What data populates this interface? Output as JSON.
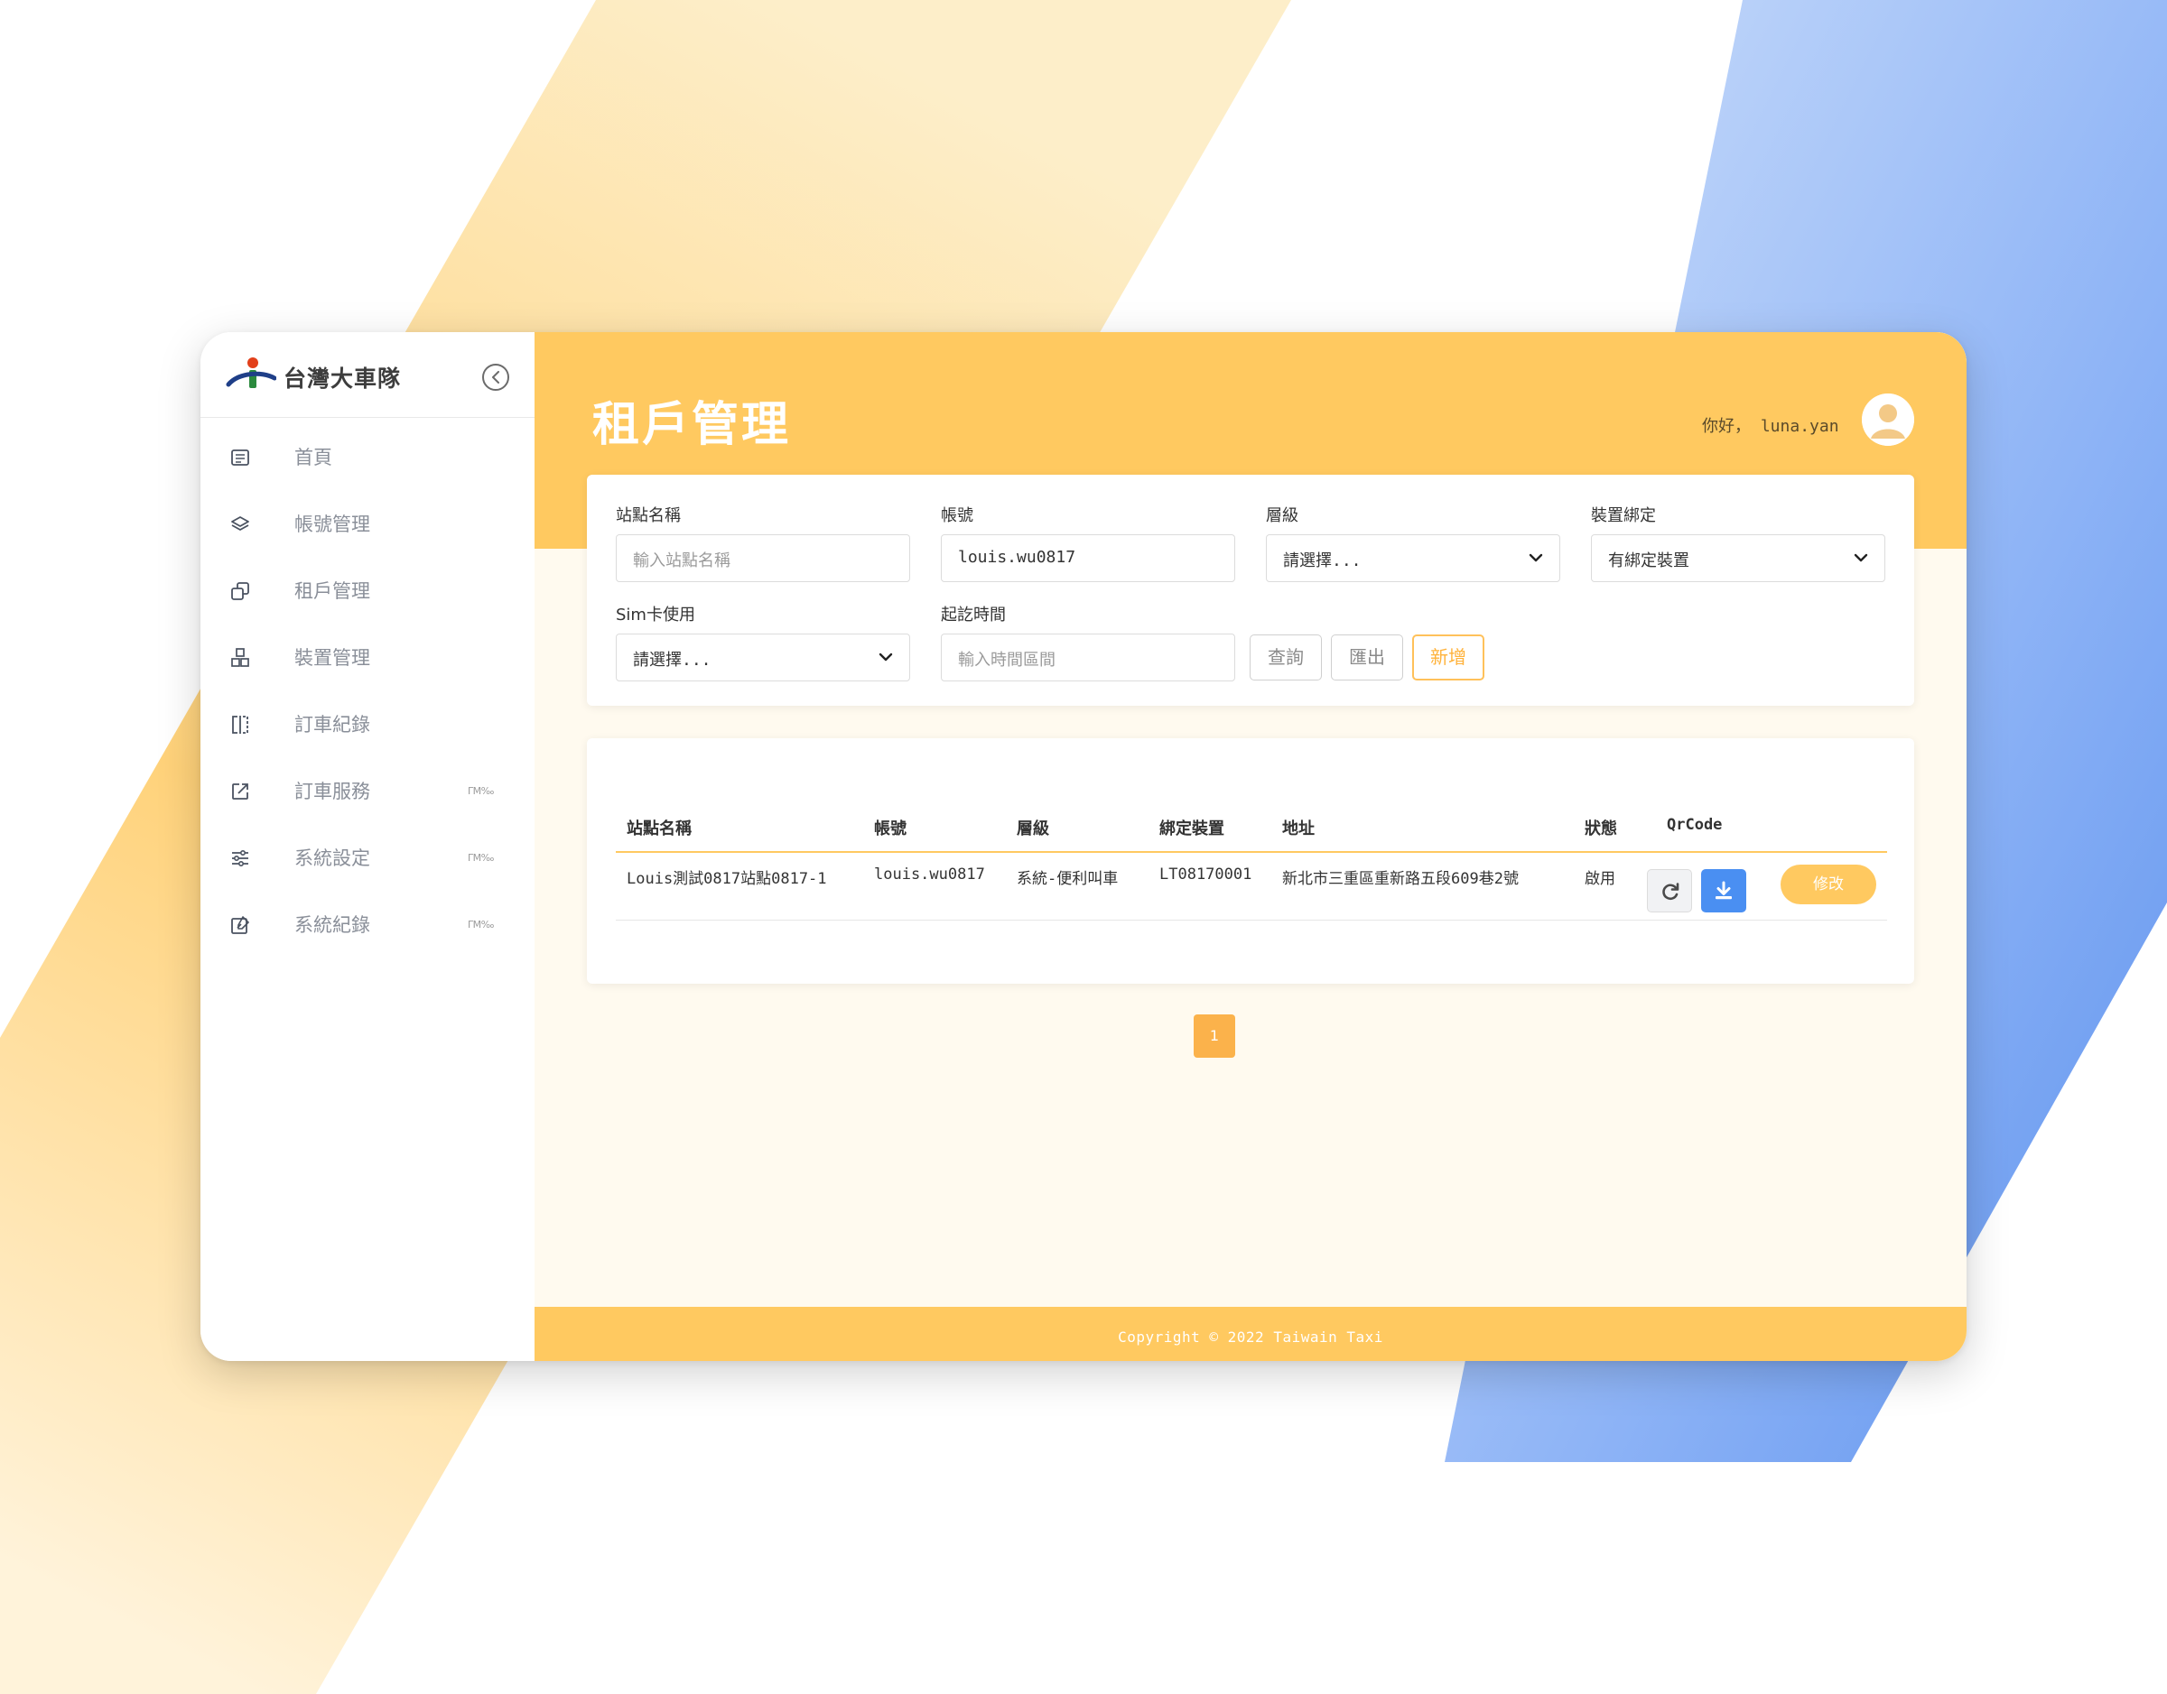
{
  "app": {
    "brand": "台灣大車隊",
    "page_title": "租戶管理",
    "greeting": "你好，",
    "username": "luna.yan",
    "footer": "Copyright © 2022 Taiwain Taxi"
  },
  "colors": {
    "accent": "#ffc960",
    "accent_dark": "#fbb24b",
    "primary_blue": "#4a8ff2",
    "content_bg": "#fffaef"
  },
  "sidebar": {
    "items": [
      {
        "label": "首頁",
        "icon": "newspaper-icon",
        "badge": ""
      },
      {
        "label": "帳號管理",
        "icon": "layers-icon",
        "badge": ""
      },
      {
        "label": "租戶管理",
        "icon": "copy-icon",
        "badge": ""
      },
      {
        "label": "裝置管理",
        "icon": "boxes-icon",
        "badge": ""
      },
      {
        "label": "訂車紀錄",
        "icon": "columns-icon",
        "badge": ""
      },
      {
        "label": "訂車服務",
        "icon": "external-link-icon",
        "badge": "ΓΜ‰"
      },
      {
        "label": "系統設定",
        "icon": "sliders-icon",
        "badge": "ΓΜ‰"
      },
      {
        "label": "系統紀錄",
        "icon": "edit-log-icon",
        "badge": "ΓΜ‰"
      }
    ]
  },
  "filters": {
    "station_name": {
      "label": "站點名稱",
      "placeholder": "輸入站點名稱"
    },
    "account": {
      "label": "帳號",
      "value": "louis.wu0817"
    },
    "level": {
      "label": "層級",
      "selected": "請選擇..."
    },
    "device_binding": {
      "label": "裝置綁定",
      "selected": "有綁定裝置"
    },
    "sim_usage": {
      "label": "Sim卡使用",
      "selected": "請選擇..."
    },
    "time_range": {
      "label": "起訖時間",
      "placeholder": "輸入時間區間"
    },
    "buttons": {
      "query": "查詢",
      "export": "匯出",
      "add": "新增"
    }
  },
  "table": {
    "headers": [
      "站點名稱",
      "帳號",
      "層級",
      "綁定裝置",
      "地址",
      "狀態",
      "QrCode"
    ],
    "rows": [
      {
        "station": "Louis測試0817站點0817-1",
        "account": "louis.wu0817",
        "level": "系統-便利叫車",
        "device": "LT08170001",
        "address": "新北市三重區重新路五段609巷2號",
        "status": "啟用",
        "edit_label": "修改"
      }
    ]
  },
  "pagination": {
    "current": "1"
  }
}
